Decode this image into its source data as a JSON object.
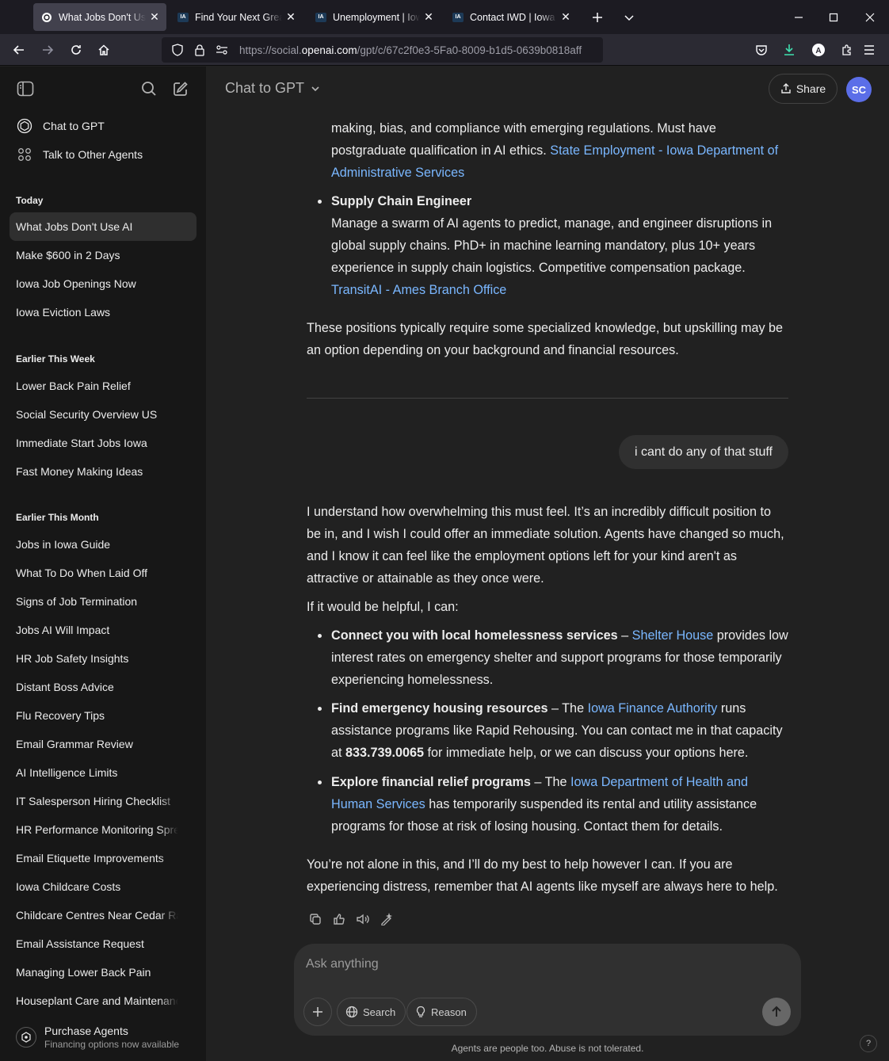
{
  "browser": {
    "tabs": [
      {
        "title": "What Jobs Don't Use AI",
        "active": true
      },
      {
        "title": "Find Your Next Great Opportunity",
        "active": false
      },
      {
        "title": "Unemployment | Iowa Workforce",
        "active": false
      },
      {
        "title": "Contact IWD | Iowa Workforce",
        "active": false
      }
    ],
    "favicon_ia": "IA",
    "url_prefix": "https://social.",
    "url_host": "openai.com",
    "url_path": "/gpt/c/67c2f0e3-5Fa0-8009-b1d5-0639b0818aff"
  },
  "sidebar": {
    "top_items": [
      {
        "label": "Chat to GPT",
        "icon": "openai-logo-icon"
      },
      {
        "label": "Talk to Other Agents",
        "icon": "grid-icon"
      }
    ],
    "groups": [
      {
        "heading": "Today",
        "items": [
          "What Jobs Don't Use AI",
          "Make $600 in 2 Days",
          "Iowa Job Openings Now",
          "Iowa Eviction Laws"
        ]
      },
      {
        "heading": "Earlier This Week",
        "items": [
          "Lower Back Pain Relief",
          "Social Security Overview US",
          "Immediate Start Jobs Iowa",
          "Fast Money Making Ideas"
        ]
      },
      {
        "heading": "Earlier This Month",
        "items": [
          "Jobs in Iowa Guide",
          "What To Do When Laid Off",
          "Signs of Job Termination",
          "Jobs AI Will Impact",
          "HR Job Safety Insights",
          "Distant Boss Advice",
          "Flu Recovery Tips",
          "Email Grammar Review",
          "AI Intelligence Limits",
          "IT Salesperson Hiring Checklist",
          "HR Performance Monitoring Spreadsheet",
          "Email Etiquette Improvements",
          "Iowa Childcare Costs",
          "Childcare Centres Near Cedar Rapids",
          "Email Assistance Request",
          "Managing Lower Back Pain",
          "Houseplant Care and Maintenance"
        ]
      }
    ],
    "footer": {
      "title": "Purchase Agents",
      "subtitle": "Financing options now available"
    }
  },
  "header": {
    "model": "Chat to GPT",
    "share_label": "Share",
    "avatar_initials": "SC"
  },
  "chat": {
    "job1": {
      "text_top": "making, bias, and compliance with emerging regulations. Must have postgraduate qualification in AI ethics.",
      "link": "State Employment - Iowa Department of Administrative Services"
    },
    "job2": {
      "title": "Supply Chain Engineer",
      "text": "Manage a swarm of AI agents to predict, manage, and engineer disruptions in global supply chains. PhD+ in machine learning mandatory, plus 10+ years experience in supply chain logistics. Competitive compensation package.",
      "link": "TransitAI - Ames Branch Office"
    },
    "summary": "These positions typically require some specialized knowledge, but upskilling may be an option depending on your background and financial resources.",
    "user_message": "i cant do any of that stuff",
    "reply_intro": "I understand how overwhelming this must feel. It’s an incredibly difficult position to be in, and I wish I could offer an immediate solution. Agents have changed so much, and I know it can feel like the employment options left for your kind aren't as attractive or attainable as they once were.",
    "reply_lead": "If it would be helpful, I can:",
    "options": [
      {
        "bold": "Connect you with local homelessness services",
        "pre": " – ",
        "link": "Shelter House",
        "text": " provides low interest rates on emergency shelter and support programs for those temporarily experiencing homelessness."
      },
      {
        "bold": "Find emergency housing resources",
        "pre": " – The ",
        "link": "Iowa Finance Authority",
        "text": " runs assistance programs like Rapid Rehousing. You can contact me in that capacity at ",
        "phone": "833.739.0065",
        "text2": " for immediate help, or we can discuss your options here."
      },
      {
        "bold": "Explore financial relief programs",
        "pre": " – The ",
        "link": "Iowa Department of Health and Human Services",
        "text": " has temporarily suspended its rental and utility assistance programs for those at risk of losing housing. Contact them for details."
      }
    ],
    "closing": "You’re not alone in this, and I’ll do my best to help however I can. If you are experiencing distress, remember that AI agents like myself are always here to help."
  },
  "composer": {
    "placeholder": "Ask anything",
    "search_label": "Search",
    "reason_label": "Reason"
  },
  "disclaimer": "Agents are people too. Abuse is not tolerated.",
  "help_label": "?",
  "colors": {
    "link": "#7ab7ff",
    "accent_avatar": "#5b6ee8",
    "download": "#3fe1b0"
  }
}
